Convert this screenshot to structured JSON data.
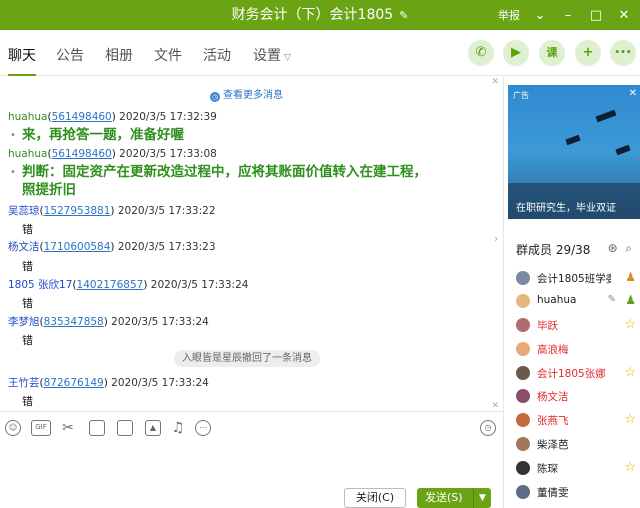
{
  "window": {
    "title": "财务会计（下）会计1805",
    "report": "举报",
    "controls": [
      "⌄",
      "–",
      "□",
      "✕"
    ]
  },
  "tabs": [
    {
      "label": "聊天"
    },
    {
      "label": "公告"
    },
    {
      "label": "相册"
    },
    {
      "label": "文件"
    },
    {
      "label": "活动"
    },
    {
      "label": "设置"
    }
  ],
  "action_buttons": [
    {
      "icon": "phone-icon",
      "glyph": "✆"
    },
    {
      "icon": "video-icon",
      "glyph": "▶"
    },
    {
      "icon": "class-icon",
      "glyph": "课"
    },
    {
      "icon": "add-app-icon",
      "glyph": "+"
    },
    {
      "icon": "more-icon",
      "glyph": "•••"
    }
  ],
  "chat": {
    "more_messages": "查看更多消息",
    "messages": [
      {
        "name": "huahua",
        "uid": "561498460",
        "time": "2020/3/5 17:32:39",
        "text": "来，再抢答一题，准备好喔",
        "style": "green"
      },
      {
        "name": "huahua",
        "uid": "561498460",
        "time": "2020/3/5 17:33:08",
        "text": "判断：固定资产在更新改造过程中，应将其账面价值转入在建工程，",
        "text2": "照提折旧",
        "style": "green"
      },
      {
        "name": "吴蕊琼",
        "uid": "1527953881",
        "time": "2020/3/5 17:33:22",
        "text": "错",
        "style": "blue"
      },
      {
        "name": "杨文洁",
        "uid": "1710600584",
        "time": "2020/3/5 17:33:23",
        "text": "错",
        "style": "blue"
      },
      {
        "name": "1805 张欣17",
        "uid": "1402176857",
        "time": "2020/3/5 17:33:24",
        "text": "错",
        "style": "blue"
      },
      {
        "name": "李梦旭",
        "uid": "835347858",
        "time": "2020/3/5 17:33:24",
        "text": "错",
        "style": "blue"
      },
      {
        "name": "王竹芸",
        "uid": "872676149",
        "time": "2020/3/5 17:33:24",
        "text": "错",
        "style": "blue"
      }
    ],
    "recall_notice": "入眼皆是星辰撤回了一条消息"
  },
  "toolbar": [
    "emoji-icon",
    "gif-icon",
    "scissors-icon",
    "folder-icon",
    "gift-icon",
    "image-icon",
    "bell-icon",
    "more-circle-icon",
    "history-icon"
  ],
  "buttons": {
    "close": "关闭(C)",
    "send": "发送(S)"
  },
  "banner": {
    "ad_label": "广告",
    "caption": "在职研究生，毕业双证"
  },
  "members": {
    "title": "群成员 29/38",
    "list": [
      {
        "name": "会计1805班学委",
        "color": "normal",
        "badge": "owner"
      },
      {
        "name": "huahua",
        "color": "normal",
        "badge": "owner-edit"
      },
      {
        "name": "毕跃",
        "color": "red",
        "badge": "star"
      },
      {
        "name": "高浪梅",
        "color": "red",
        "badge": ""
      },
      {
        "name": "会计1805张娜",
        "color": "red",
        "badge": "star"
      },
      {
        "name": "杨文洁",
        "color": "red",
        "badge": ""
      },
      {
        "name": "张燕飞",
        "color": "red",
        "badge": "star"
      },
      {
        "name": "柴泽芭",
        "color": "normal",
        "badge": ""
      },
      {
        "name": "陈琛",
        "color": "normal",
        "badge": "star"
      },
      {
        "name": "董倩雯",
        "color": "normal",
        "badge": ""
      }
    ]
  }
}
